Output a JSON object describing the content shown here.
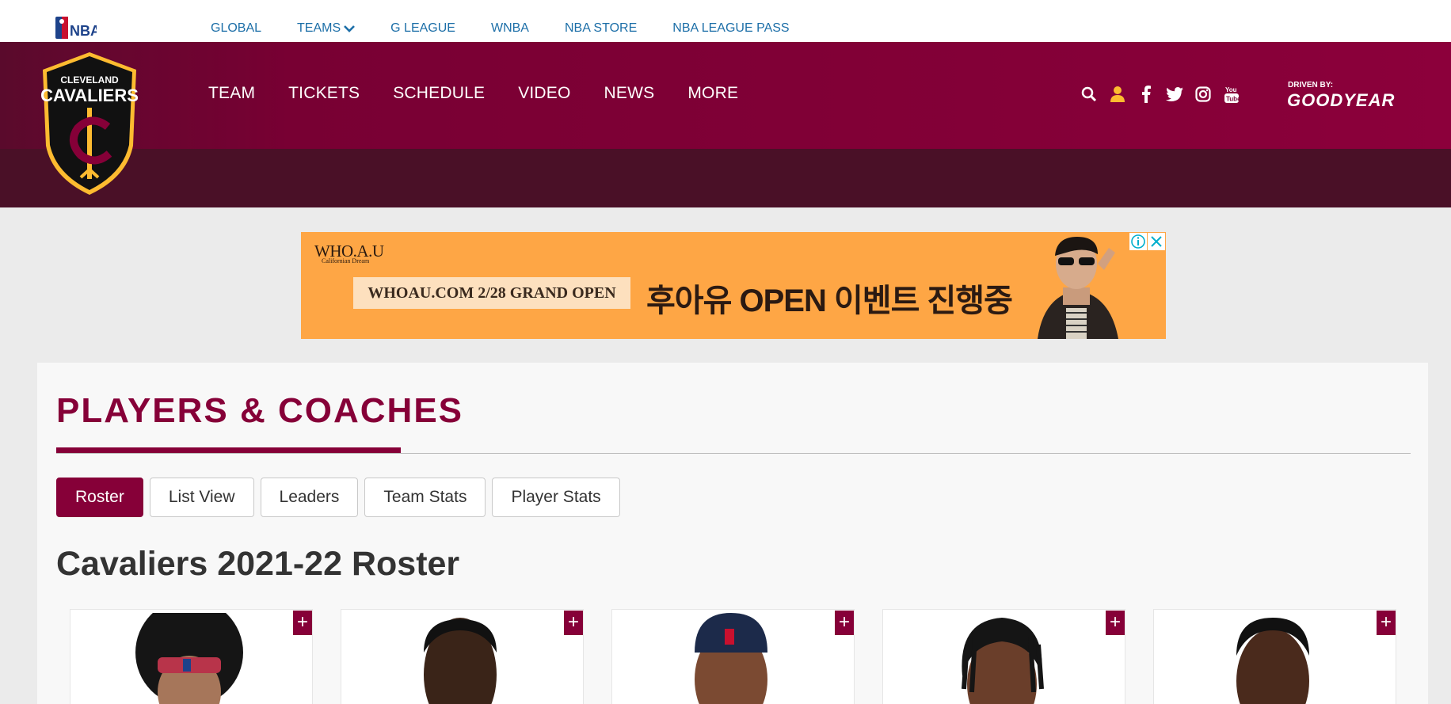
{
  "league_bar": {
    "logo_label": "NBA",
    "links": [
      "GLOBAL",
      "TEAMS",
      "G LEAGUE",
      "WNBA",
      "NBA STORE",
      "NBA LEAGUE PASS"
    ]
  },
  "team": {
    "logo_line1": "CLEVELAND",
    "logo_line2": "CAVALIERS",
    "nav": [
      "TEAM",
      "TICKETS",
      "SCHEDULE",
      "VIDEO",
      "NEWS",
      "MORE"
    ],
    "sponsor_top": "DRIVEN BY:",
    "sponsor_name": "GOODYEAR",
    "icons": [
      "search-icon",
      "user-icon",
      "facebook-icon",
      "twitter-icon",
      "instagram-icon",
      "youtube-icon"
    ],
    "colors": {
      "wine": "#860038",
      "dark": "#4a1027",
      "gold": "#fdbb30"
    }
  },
  "ad": {
    "brand": "WHO.A.U",
    "brand_sub": "Californian Dream",
    "box_text": "WHOAU.COM 2/28 GRAND OPEN",
    "headline": "후아유 OPEN 이벤트 진행중"
  },
  "content": {
    "section_title": "PLAYERS & COACHES",
    "tabs": [
      "Roster",
      "List View",
      "Leaders",
      "Team Stats",
      "Player Stats"
    ],
    "active_tab": "Roster",
    "roster_title": "Cavaliers 2021-22 Roster",
    "card_plus": "+"
  }
}
